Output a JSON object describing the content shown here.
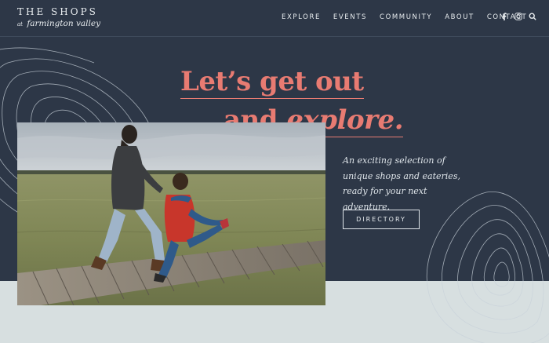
{
  "brand": {
    "name": "THE SHOPS",
    "at": "at",
    "location": "farmington valley"
  },
  "nav": {
    "items": [
      "EXPLORE",
      "EVENTS",
      "COMMUNITY",
      "ABOUT",
      "CONTACT"
    ],
    "icons": [
      "facebook-icon",
      "instagram-icon",
      "search-icon"
    ]
  },
  "hero": {
    "headline_line1": "Let’s get out",
    "headline_line2_plain": "and ",
    "headline_line2_italic": "explore.",
    "tagline": "An exciting selection of unique shops and eateries, ready for your next adventure.",
    "button_label": "DIRECTORY"
  },
  "colors": {
    "background": "#2d3747",
    "accent": "#e87b72",
    "band": "#d7dfe0",
    "text": "#e8ecef"
  }
}
